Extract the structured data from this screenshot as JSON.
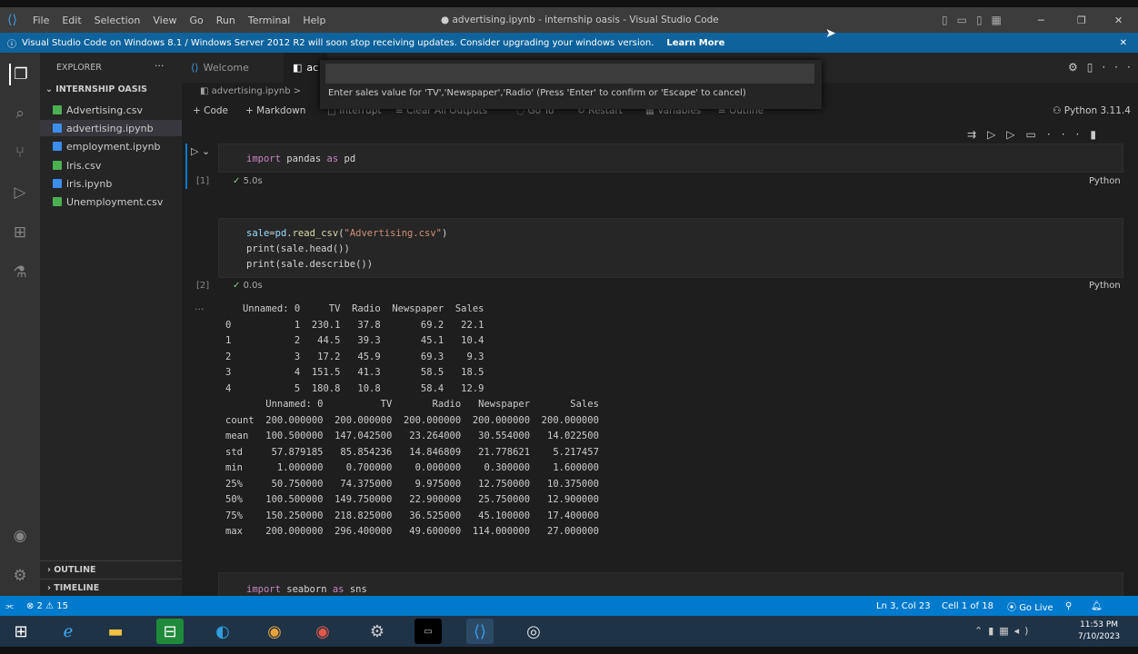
{
  "window": {
    "title": "● advertising.ipynb - internship oasis - Visual Studio Code",
    "menu": [
      "File",
      "Edit",
      "Selection",
      "View",
      "Go",
      "Run",
      "Terminal",
      "Help"
    ]
  },
  "banner": {
    "text": "Visual Studio Code on Windows 8.1 / Windows Server 2012 R2 will soon stop receiving updates. Consider upgrading your windows version.",
    "link": "Learn More"
  },
  "sidebar": {
    "header": "EXPLORER",
    "folder": "INTERNSHIP OASIS",
    "files": [
      {
        "name": "Advertising.csv",
        "color": "#4caf50"
      },
      {
        "name": "advertising.ipynb",
        "color": "#3b8eea"
      },
      {
        "name": "employment.ipynb",
        "color": "#3b8eea"
      },
      {
        "name": "Iris.csv",
        "color": "#4caf50"
      },
      {
        "name": "iris.ipynb",
        "color": "#3b8eea"
      },
      {
        "name": "Unemployment.csv",
        "color": "#4caf50"
      }
    ],
    "outline": "OUTLINE",
    "timeline": "TIMELINE"
  },
  "tabs": {
    "welcome": "Welcome",
    "active": "ac"
  },
  "breadcrumb": "advertising.ipynb >",
  "toolbar": {
    "code": "Code",
    "markdown": "Markdown",
    "interrupt": "Interrupt",
    "clear": "Clear All Outputs",
    "goto": "Go To",
    "restart": "Restart",
    "variables": "Variables",
    "outline": "Outline",
    "kernel": "Python 3.11.4"
  },
  "quickpick": {
    "message": "Enter sales value for 'TV','Newspaper','Radio' (Press 'Enter' to confirm or 'Escape' to cancel)"
  },
  "cells": [
    {
      "exec": "[1]",
      "time": "5.0s",
      "lang": "Python"
    },
    {
      "exec": "[2]",
      "time": "0.0s",
      "lang": "Python"
    }
  ],
  "code1": {
    "kw": "import",
    "a": " pandas ",
    "as": "as",
    "b": " pd"
  },
  "code2": {
    "l1a": "sale=pd.",
    "l1fn": "read_csv",
    "l1b": "(",
    "l1str": "\"Advertising.csv\"",
    "l1c": ")",
    "l2": "print(sale.head())",
    "l3": "print(sale.describe())"
  },
  "output": {
    "head_table": "   Unnamed: 0     TV  Radio  Newspaper  Sales\n0           1  230.1   37.8       69.2   22.1\n1           2   44.5   39.3       45.1   10.4\n2           3   17.2   45.9       69.3    9.3\n3           4  151.5   41.3       58.5   18.5\n4           5  180.8   10.8       58.4   12.9",
    "describe_table": "       Unnamed: 0          TV       Radio   Newspaper       Sales\ncount  200.000000  200.000000  200.000000  200.000000  200.000000\nmean   100.500000  147.042500   23.264000   30.554000   14.022500\nstd     57.879185   85.854236   14.846809   21.778621    5.217457\nmin      1.000000    0.700000    0.000000    0.300000    1.600000\n25%     50.750000   74.375000    9.975000   12.750000   10.375000\n50%    100.500000  149.750000   22.900000   25.750000   12.900000\n75%    150.250000  218.825000   36.525000   45.100000   17.400000\nmax    200.000000  296.400000   49.600000  114.000000   27.000000"
  },
  "code3": {
    "kw": "import",
    "a": " seaborn ",
    "as": "as",
    "b": " sns"
  },
  "status": {
    "problems": "⊗ 2 ⚠ 15",
    "position": "Ln 3, Col 23",
    "cell": "Cell 1 of 18",
    "golive": "Go Live"
  },
  "clock": {
    "time": "11:53 PM",
    "date": "7/10/2023"
  }
}
